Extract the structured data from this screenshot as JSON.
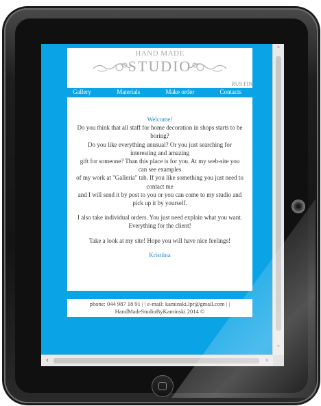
{
  "site": {
    "logo": {
      "line1": "HAND MADE",
      "line2": "STUDIO"
    },
    "language_switch": "RUS FIN",
    "nav": [
      {
        "label": "Gallery"
      },
      {
        "label": "Materials"
      },
      {
        "label": "Make order"
      },
      {
        "label": "Contacts"
      }
    ],
    "content": {
      "welcome": "Welcome!",
      "paragraph1": [
        "Do you think that all staff for home decoration in shops starts to be boring?",
        "Do you like everything unusual? Or you just searching for interesting and amazing",
        "gift for someone? Than this place is for you. At my web-site you can see examples",
        "of my work at \"Galleria\" tab. If you like something you just need to contact me",
        "and I will send it by post to you or you can come to my studio and pick up it by yourself."
      ],
      "paragraph2": "I also take individual orders. You just need explain what you want. Everything for the client!",
      "paragraph3": "Take a look at my site! Hope you will have nice feelings!",
      "signature": "Kristiina"
    },
    "footer": {
      "line1": "phone: 044 987 18 91 | | e-mail: kaminski.lpr@gmail.com | |",
      "line2": "HandMadeStudioByKaminski 2014 ©"
    }
  },
  "colors": {
    "page_background": "#0aa3e6",
    "accent_text": "#1a86c8",
    "logo_gray": "#a9a9a9"
  }
}
